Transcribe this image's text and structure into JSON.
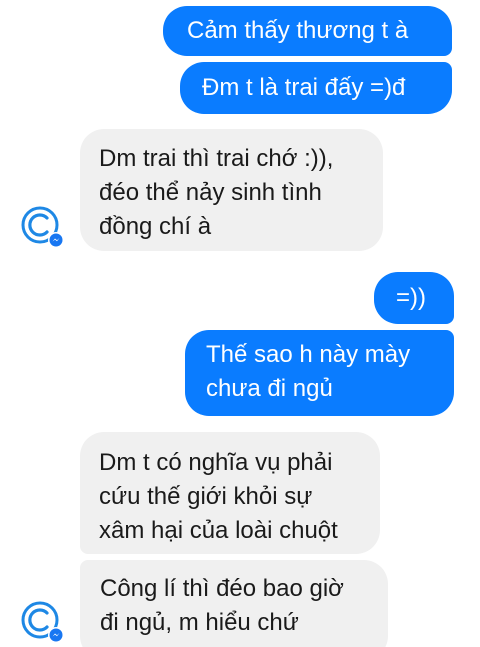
{
  "messages": [
    {
      "id": "b1",
      "direction": "outgoing",
      "lines": [
        "Cảm thấy thương t à"
      ]
    },
    {
      "id": "b2",
      "direction": "outgoing",
      "lines": [
        "Đm t là trai đấy =)đ"
      ]
    },
    {
      "id": "b3",
      "direction": "incoming",
      "lines": [
        "Dm trai thì trai chớ :)),",
        "đéo thể nảy sinh tình",
        "đồng chí à"
      ]
    },
    {
      "id": "b4",
      "direction": "outgoing",
      "lines": [
        "=))"
      ]
    },
    {
      "id": "b5",
      "direction": "outgoing",
      "lines": [
        "Thế sao h này mày",
        "chưa đi ngủ"
      ]
    },
    {
      "id": "b6",
      "direction": "incoming",
      "lines": [
        "Dm t có nghĩa vụ phải",
        "cứu thế giới khỏi sự",
        "xâm hại của loài chuột"
      ]
    },
    {
      "id": "b7",
      "direction": "incoming",
      "lines": [
        "Công lí thì đéo bao giờ",
        "đi ngủ, m hiểu chứ"
      ]
    }
  ],
  "avatar": {
    "icon": "copyright-logo-avatar-icon",
    "badge_icon": "messenger-badge-icon"
  },
  "colors": {
    "outgoing_bubble": "#0a7cff",
    "outgoing_text": "#ffffff",
    "incoming_bubble": "#f0f0f0",
    "incoming_text": "#1a1a1a",
    "avatar_logo": "#1e88e5",
    "badge": "#1877f2"
  }
}
